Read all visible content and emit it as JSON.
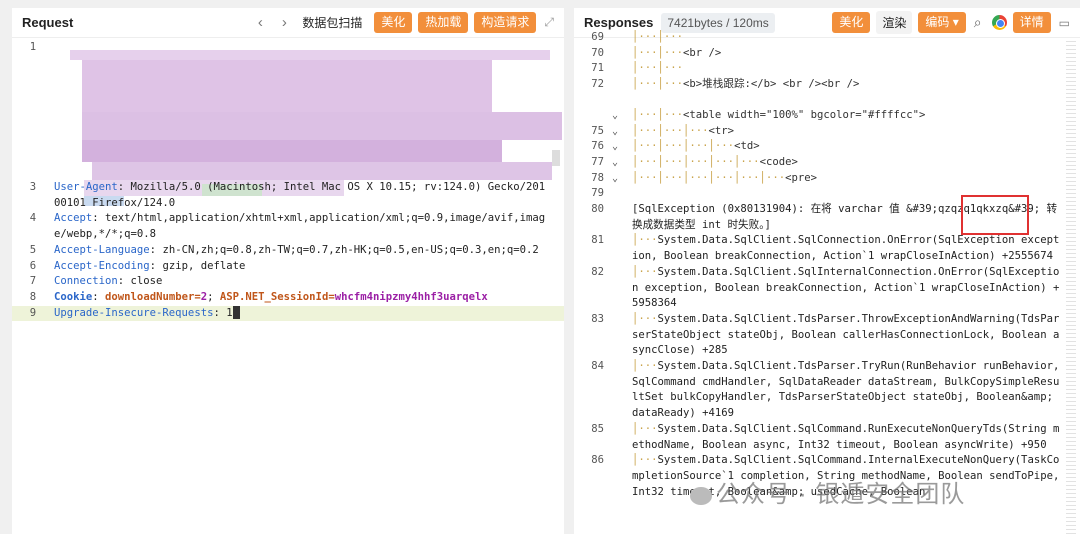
{
  "request": {
    "title": "Request",
    "toolbar": {
      "prev_arrow": "‹",
      "next_arrow": "›",
      "scan_label": "数据包扫描",
      "beautify_label": "美化",
      "hot_load_label": "热加载",
      "construct_label": "构造请求",
      "expand_icon": "expand-icon"
    },
    "lines": [
      {
        "n": "1",
        "key": "",
        "val": ""
      },
      {
        "n": "3",
        "key": "User-Agent",
        "val": " Mozilla/5.0 (Macintosh; Intel Mac OS X 10.15; rv:124.0) Gecko/20100101 Firefox/124.0"
      },
      {
        "n": "4",
        "key": "Accept",
        "val": " text/html,application/xhtml+xml,application/xml;q=0.9,image/avif,image/webp,*/*;q=0.8"
      },
      {
        "n": "5",
        "key": "Accept-Language",
        "val": " zh-CN,zh;q=0.8,zh-TW;q=0.7,zh-HK;q=0.5,en-US;q=0.3,en;q=0.2"
      },
      {
        "n": "6",
        "key": "Accept-Encoding",
        "val": " gzip, deflate"
      },
      {
        "n": "7",
        "key": "Connection",
        "val": " close"
      },
      {
        "n": "8",
        "key": "Cookie",
        "cookie1_key": "downloadNumber",
        "cookie1_val": "2",
        "cookie2_key": "ASP.NET_SessionId",
        "cookie2_val": "whcfm4nipzmy4hhf3uarqelx"
      },
      {
        "n": "9",
        "key": "Upgrade-Insecure-Requests",
        "val": " 1"
      }
    ]
  },
  "response": {
    "title": "Responses",
    "size_label": "7421bytes / 120ms",
    "toolbar": {
      "beautify_label": "美化",
      "render_label": "渲染",
      "encoding_label": "编码",
      "details_label": "详情"
    },
    "lines": [
      {
        "n": "69",
        "fold": "",
        "indent": 2,
        "text": ""
      },
      {
        "n": "70",
        "fold": "",
        "indent": 2,
        "text": "<br />"
      },
      {
        "n": "71",
        "fold": "",
        "indent": 2,
        "text": ""
      },
      {
        "n": "72",
        "fold": "",
        "indent": 2,
        "text": "<b>堆栈跟踪:</b> <br /><br />"
      },
      {
        "n": "",
        "fold": "",
        "indent": 0,
        "text": ""
      },
      {
        "n": "",
        "fold": "v",
        "indent": 2,
        "text": "<table width=\"100%\" bgcolor=\"#ffffcc\">"
      },
      {
        "n": "75",
        "fold": "v",
        "indent": 3,
        "text": "<tr>"
      },
      {
        "n": "76",
        "fold": "v",
        "indent": 4,
        "text": "<td>"
      },
      {
        "n": "77",
        "fold": "v",
        "indent": 5,
        "text": "<code>"
      },
      {
        "n": "78",
        "fold": "v",
        "indent": 6,
        "text": "<pre>"
      },
      {
        "n": "79",
        "fold": "",
        "indent": 0,
        "text": ""
      },
      {
        "n": "80",
        "fold": "",
        "indent": 0,
        "text": "[SqlException (0x80131904): 在将 varchar 值 &#39;qzqzq1qkxzq&#39; 转换成数据类型 int 时失败。]"
      },
      {
        "n": "81",
        "fold": "",
        "indent": 1,
        "text": "System.Data.SqlClient.SqlConnection.OnError(SqlException exception, Boolean breakConnection, Action`1 wrapCloseInAction) +2555674"
      },
      {
        "n": "82",
        "fold": "",
        "indent": 1,
        "text": "System.Data.SqlClient.SqlInternalConnection.OnError(SqlException exception, Boolean breakConnection, Action`1 wrapCloseInAction) +5958364"
      },
      {
        "n": "83",
        "fold": "",
        "indent": 1,
        "text": "System.Data.SqlClient.TdsParser.ThrowExceptionAndWarning(TdsParserStateObject stateObj, Boolean callerHasConnectionLock, Boolean asyncClose) +285"
      },
      {
        "n": "84",
        "fold": "",
        "indent": 1,
        "text": "System.Data.SqlClient.TdsParser.TryRun(RunBehavior runBehavior, SqlCommand cmdHandler, SqlDataReader dataStream, BulkCopySimpleResultSet bulkCopyHandler, TdsParserStateObject stateObj, Boolean&amp; dataReady) +4169"
      },
      {
        "n": "85",
        "fold": "",
        "indent": 1,
        "text": "System.Data.SqlClient.SqlCommand.RunExecuteNonQueryTds(String methodName, Boolean async, Int32 timeout, Boolean asyncWrite) +950"
      },
      {
        "n": "86",
        "fold": "",
        "indent": 1,
        "text": "System.Data.SqlClient.SqlCommand.InternalExecuteNonQuery(TaskCompletionSource`1 completion, String methodName, Boolean sendToPipe, Int32 timeout, Boolean&amp; usedCache, Boolean"
      }
    ]
  },
  "watermark": "公众号 · 银遁安全团队"
}
